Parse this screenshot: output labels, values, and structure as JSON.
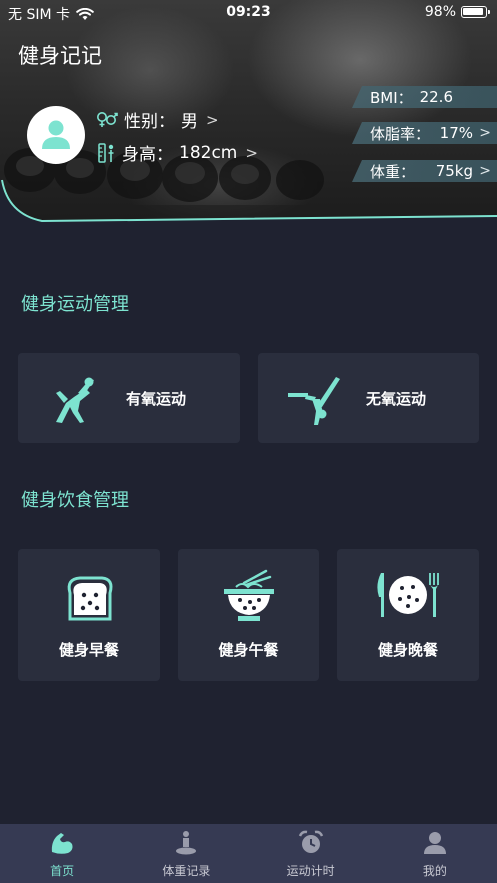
{
  "status_bar": {
    "carrier": "无 SIM 卡",
    "time": "09:23",
    "battery": "98%"
  },
  "header": {
    "title": "健身记记"
  },
  "profile": {
    "gender_label": "性别：",
    "gender_value": "男",
    "height_label": "身高：",
    "height_value": "182cm"
  },
  "stats": {
    "bmi_label": "BMI：",
    "bmi_value": "22.6",
    "bodyfat_label": "体脂率：",
    "bodyfat_value": "17%",
    "weight_label": "体重：",
    "weight_value": "75kg"
  },
  "exercise_section": {
    "title": "健身运动管理",
    "items": [
      {
        "label": "有氧运动",
        "icon": "stretching-person-icon"
      },
      {
        "label": "无氧运动",
        "icon": "one-leg-balance-person-icon"
      }
    ]
  },
  "diet_section": {
    "title": "健身饮食管理",
    "items": [
      {
        "label": "健身早餐",
        "icon": "toast-bread-icon"
      },
      {
        "label": "健身午餐",
        "icon": "noodle-bowl-icon"
      },
      {
        "label": "健身晚餐",
        "icon": "plate-knife-fork-icon"
      }
    ]
  },
  "tabbar": {
    "items": [
      {
        "label": "首页",
        "icon": "flexed-arm-icon",
        "active": true
      },
      {
        "label": "体重记录",
        "icon": "scale-person-icon",
        "active": false
      },
      {
        "label": "运动计时",
        "icon": "alarm-clock-icon",
        "active": false
      },
      {
        "label": "我的",
        "icon": "user-icon",
        "active": false
      }
    ]
  },
  "colors": {
    "accent": "#7de3d0",
    "background": "#1f2230",
    "card": "#2a2e3d",
    "tabbar": "#363a53"
  }
}
